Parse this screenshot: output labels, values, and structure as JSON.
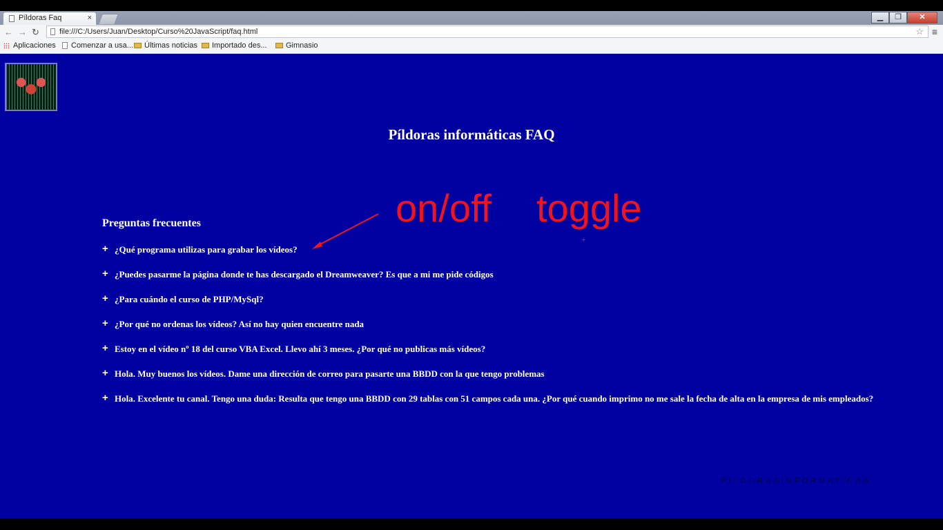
{
  "browser": {
    "tab_title": "Píldoras Faq",
    "tab_close": "×",
    "url": "file:///C:/Users/Juan/Desktop/Curso%20JavaScript/faq.html",
    "window_buttons": {
      "minimize": "▁",
      "maximize": "❐",
      "close": "✕"
    },
    "nav": {
      "back": "←",
      "forward": "→",
      "reload": "↻"
    },
    "star": "☆",
    "menu": "≡"
  },
  "bookmarks": [
    {
      "label": "Aplicaciones",
      "icon": "apps-grid-icon"
    },
    {
      "label": "Comenzar a usa...",
      "icon": "page-icon"
    },
    {
      "label": "Últimas noticias",
      "icon": "folder-icon"
    },
    {
      "label": "Importado des...",
      "icon": "folder-icon"
    },
    {
      "label": "Gimnasio",
      "icon": "folder-icon"
    }
  ],
  "page": {
    "title": "Píldoras informáticas FAQ",
    "faq_heading": "Preguntas frecuentes",
    "toggle_symbol": "+",
    "brand": "PILDORASINFORMATICAS",
    "colors": {
      "background": "#0101a2",
      "text": "#ffffff",
      "annotation": "#f0141e"
    },
    "questions": [
      "¿Qué programa utilizas para grabar los vídeos?",
      "¿Puedes pasarme la página donde te has descargado el Dreamweaver? Es que a mi me pide códigos",
      "¿Para cuándo el curso de PHP/MySql?",
      "¿Por qué no ordenas los vídeos? Así no hay quien encuentre nada",
      "Estoy en el vídeo nº 18 del curso VBA Excel. Llevo ahí 3 meses. ¿Por qué no publicas más vídeos?",
      "Hola. Muy buenos los vídeos. Dame una dirección de correo para pasarte una BBDD con la que tengo problemas",
      "Hola. Excelente tu canal. Tengo una duda: Resulta que tengo una BBDD con 29 tablas con 51 campos cada una. ¿Por qué cuando imprimo no me sale la fecha de alta en la empresa de mis empleados?"
    ]
  },
  "annotation": {
    "left_text": "on/off",
    "right_text": "toggle",
    "cursor": "+"
  }
}
